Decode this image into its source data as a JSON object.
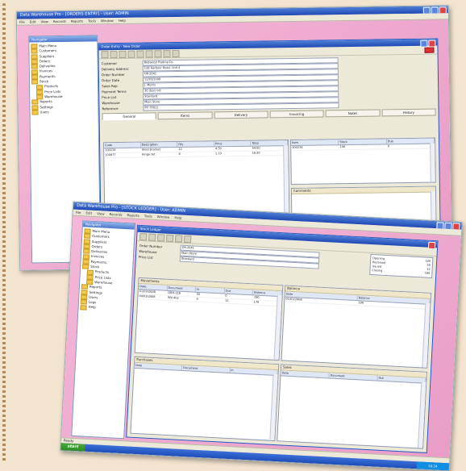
{
  "window": {
    "title": "Data Warehouse Pro - [ORDERS ENTRY] - User: ADMIN",
    "title_back": "Data Warehouse Pro - [STOCK LEDGER] - User: ADMIN"
  },
  "menu": [
    "File",
    "Edit",
    "View",
    "Records",
    "Reports",
    "Tools",
    "Window",
    "Help"
  ],
  "tree_caption": "Navigator",
  "tree": [
    "Main Menu",
    "Customers",
    "Suppliers",
    "Orders",
    "Deliveries",
    "Invoices",
    "Payments",
    "Stock",
    "Products",
    "Price Lists",
    "Warehouse",
    "Reports",
    "Settings",
    "Users",
    "Logs",
    "Help"
  ],
  "dialog": {
    "title": "Order Entry - New Order",
    "fields": [
      {
        "label": "Customer",
        "value": "Redwood Trading Co."
      },
      {
        "label": "Delivery Address",
        "value": "128 Harbour Road, Unit 4"
      },
      {
        "label": "Order Number",
        "value": "OR-2041"
      },
      {
        "label": "Order Date",
        "value": "12/03/2008"
      },
      {
        "label": "Sales Rep",
        "value": "J. Morris"
      },
      {
        "label": "Payment Terms",
        "value": "30 days net"
      },
      {
        "label": "Price List",
        "value": "Standard"
      },
      {
        "label": "Warehouse",
        "value": "Main Store"
      },
      {
        "label": "Reference",
        "value": "PO 55812"
      }
    ],
    "tabs": [
      "General",
      "Items",
      "Delivery",
      "Invoicing",
      "Notes",
      "History"
    ],
    "grid_headers": [
      "Code",
      "Description",
      "Qty",
      "Price",
      "Total"
    ],
    "grid_rows": [
      [
        "100234",
        "Steel bracket",
        "12",
        "4.50",
        "54.00"
      ],
      [
        "100877",
        "Hinge set",
        "8",
        "2.10",
        "16.80"
      ]
    ],
    "side_headers": [
      "Item",
      "Stock",
      "Due"
    ],
    "side_rows": [
      [
        "100234",
        "140",
        "0"
      ]
    ],
    "notes_caption": "Comments"
  },
  "back": {
    "dialog_title": "Stock Ledger",
    "grid_captions": [
      "Movements",
      "Balance",
      "Purchases",
      "Sales"
    ],
    "grid_headers": [
      "Date",
      "Document",
      "In",
      "Out",
      "Balance"
    ],
    "grid_rows": [
      [
        "01/03/2008",
        "GRN-118",
        "50",
        "0",
        "190"
      ],
      [
        "04/03/2008",
        "INV-402",
        "0",
        "12",
        "178"
      ]
    ],
    "summary": [
      [
        "Opening",
        "128"
      ],
      [
        "Received",
        "50"
      ],
      [
        "Issued",
        "12"
      ],
      [
        "Closing",
        "166"
      ]
    ],
    "status": "Ready",
    "start_label": "start",
    "clock": "10:24"
  }
}
